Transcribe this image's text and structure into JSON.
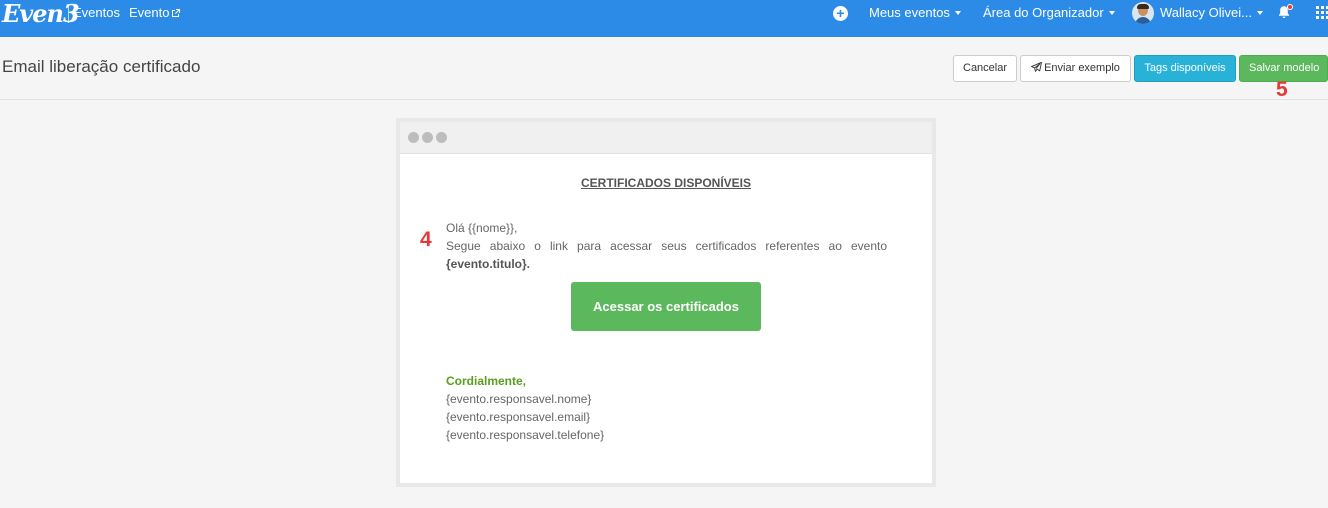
{
  "topnav": {
    "logo": "Even3",
    "eventos": "Eventos",
    "evento": "Evento",
    "meus_eventos": "Meus eventos",
    "area_organizador": "Área do Organizador",
    "user_name": "Wallacy Olivei...",
    "icons": [
      "plus-circle-icon",
      "external-link-icon",
      "avatar",
      "bell-icon",
      "apps-grid-icon"
    ],
    "colors": {
      "bar": "#2b8be6",
      "notification_dot": "#e53935"
    }
  },
  "header": {
    "title": "Email liberação certificado",
    "buttons": {
      "cancel": "Cancelar",
      "send_example": "Enviar exemplo",
      "tags": "Tags disponíveis",
      "save": "Salvar modelo"
    },
    "step_marker": "5"
  },
  "email": {
    "heading": "CERTIFICADOS DISPONÍVEIS",
    "step_marker": "4",
    "greeting": "Olá {{nome}},",
    "body": "Segue abaixo o link para acessar seus certificados referentes ao evento",
    "event_tag": "{evento.titulo}.",
    "cta": "Acessar os certificados",
    "closing": "Cordialmente,",
    "signature": [
      "{evento.responsavel.nome}",
      "{evento.responsavel.email}",
      "{evento.responsavel.telefone}"
    ],
    "colors": {
      "cta": "#5cb85c",
      "closing": "#5a9e1f"
    }
  }
}
